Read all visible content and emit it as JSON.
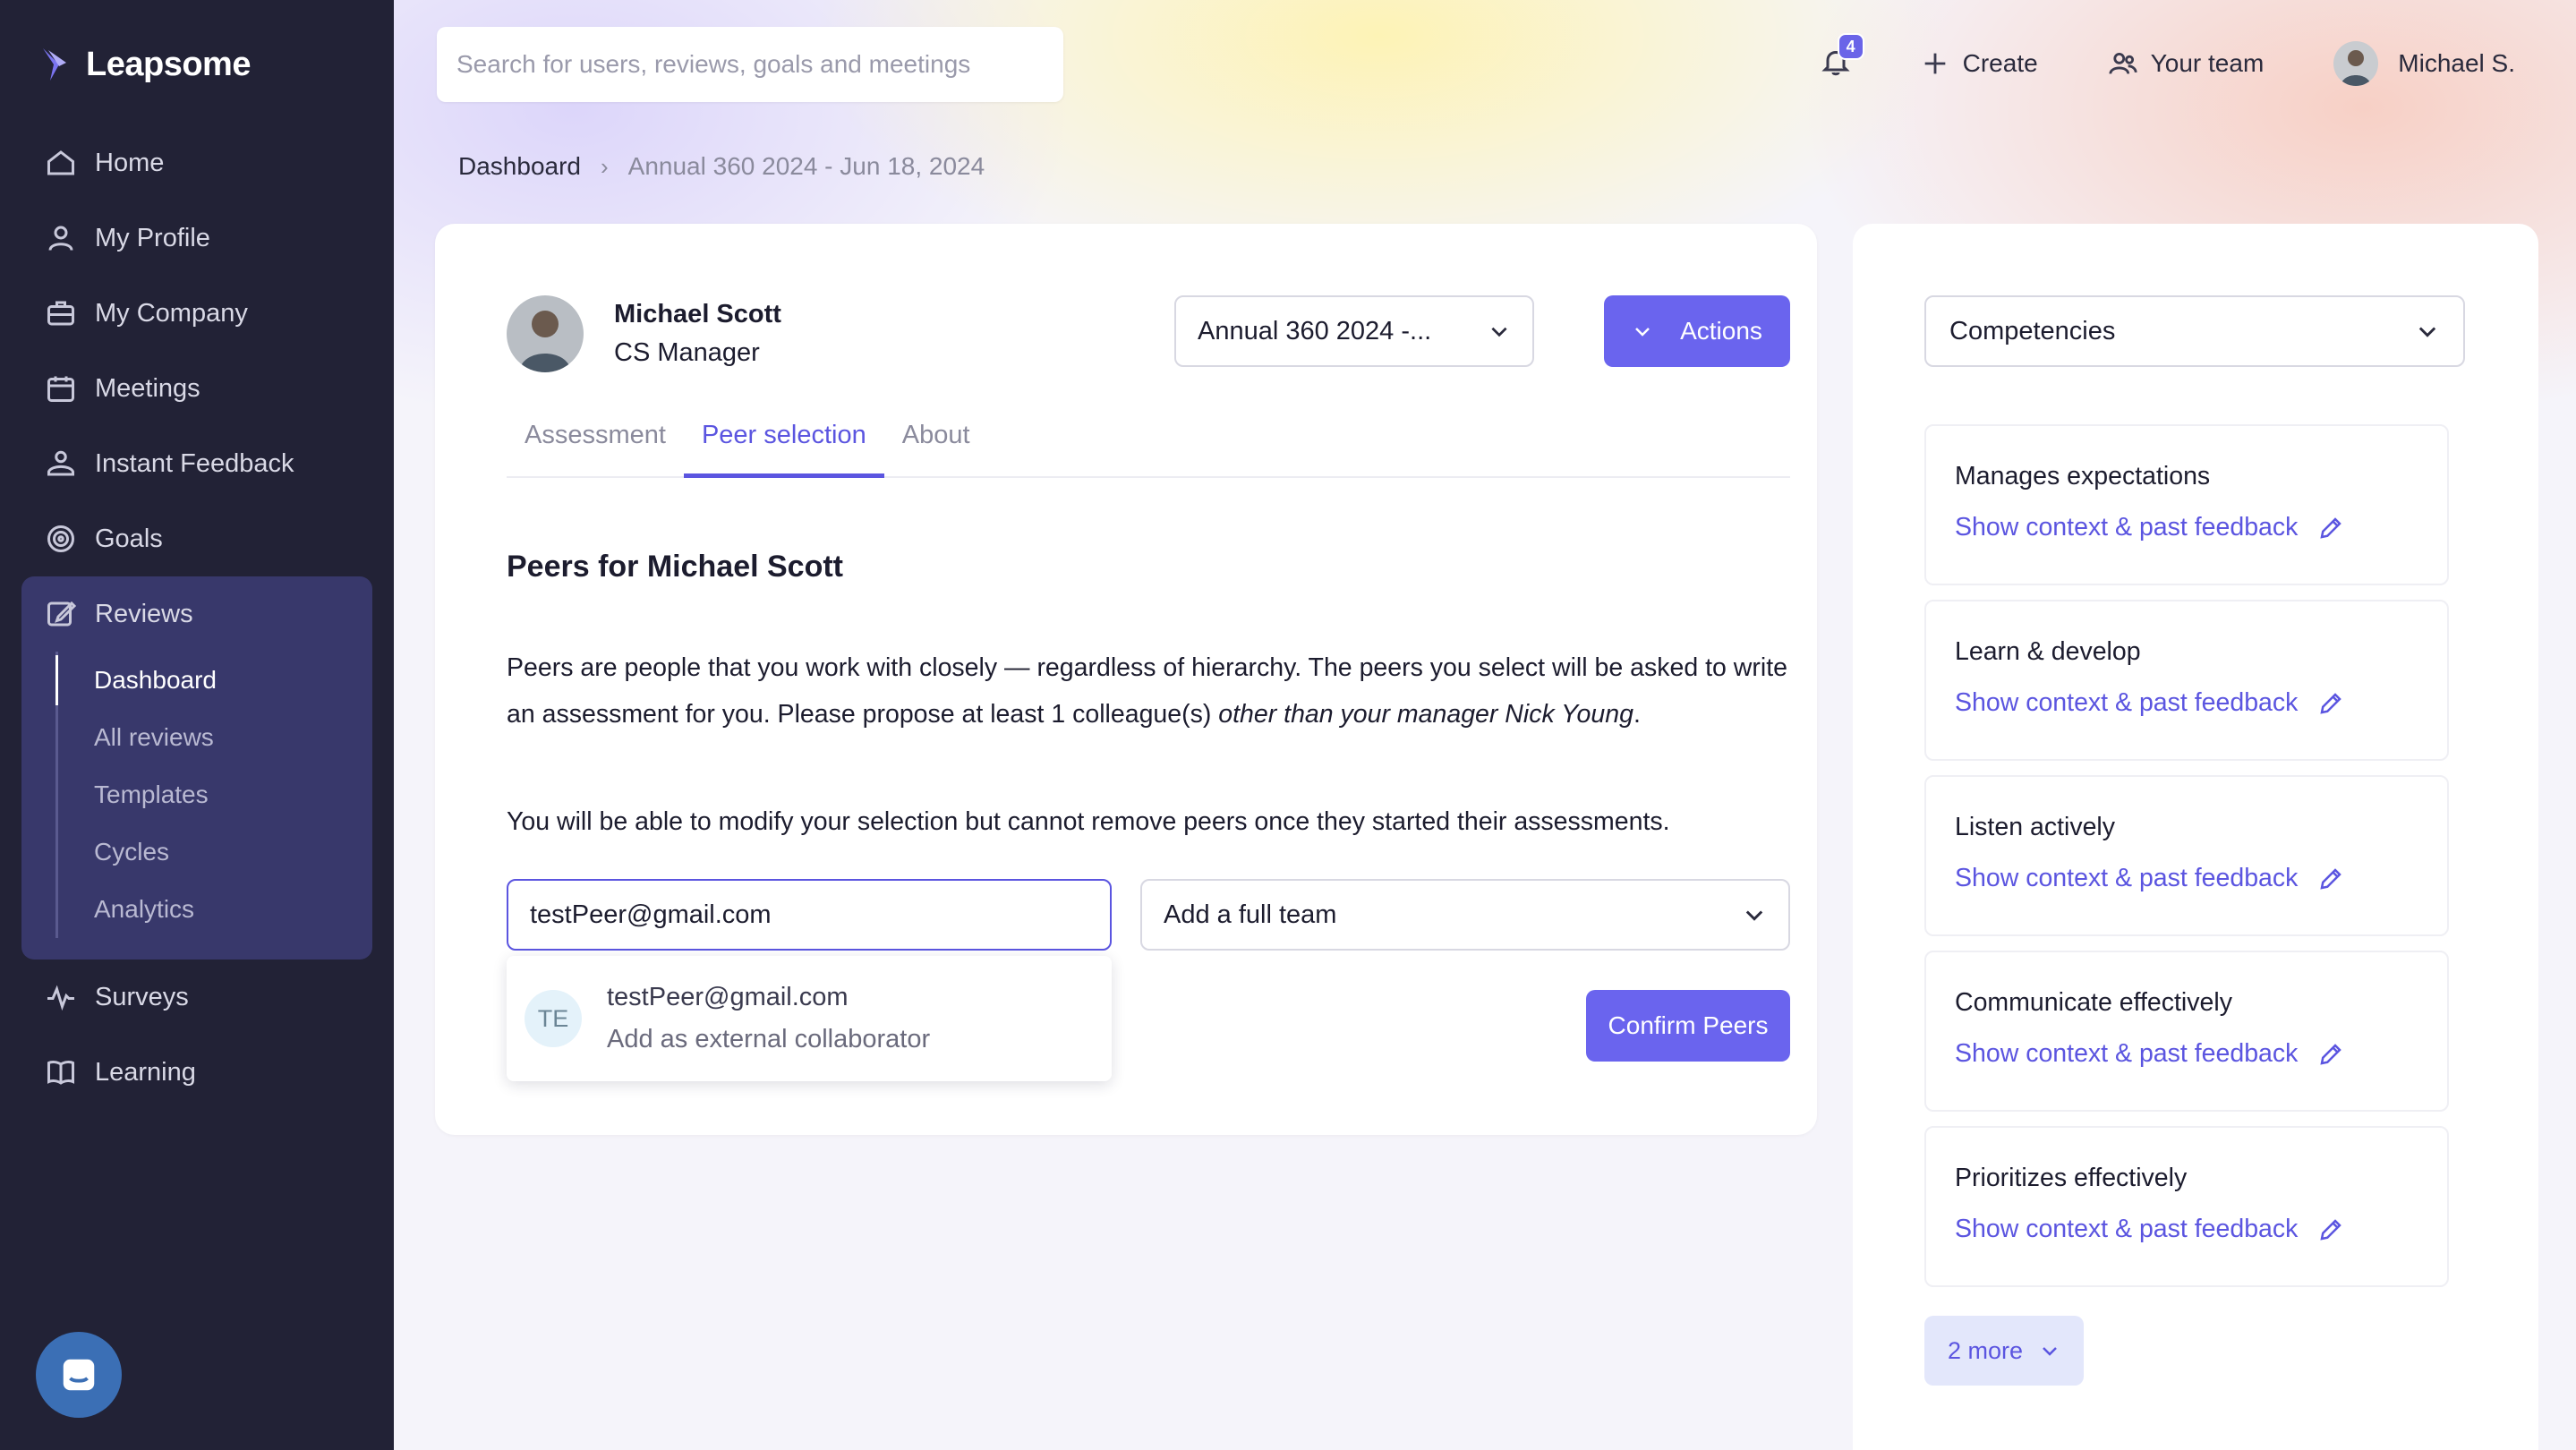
{
  "app": {
    "brand": "Leapsome"
  },
  "sidebar": {
    "items": [
      {
        "label": "Home",
        "icon": "home-icon"
      },
      {
        "label": "My Profile",
        "icon": "user-icon"
      },
      {
        "label": "My Company",
        "icon": "briefcase-icon"
      },
      {
        "label": "Meetings",
        "icon": "calendar-icon"
      },
      {
        "label": "Instant Feedback",
        "icon": "feedback-icon"
      },
      {
        "label": "Goals",
        "icon": "target-icon"
      }
    ],
    "reviews": {
      "label": "Reviews",
      "icon": "edit-icon",
      "sub_items": [
        "Dashboard",
        "All reviews",
        "Templates",
        "Cycles",
        "Analytics"
      ],
      "active_sub": "Dashboard"
    },
    "bottom_items": [
      {
        "label": "Surveys",
        "icon": "pulse-icon"
      },
      {
        "label": "Learning",
        "icon": "book-icon"
      }
    ]
  },
  "topbar": {
    "search_placeholder": "Search for users, reviews, goals and meetings",
    "notification_count": "4",
    "create_label": "Create",
    "team_label": "Your team",
    "user_label": "Michael S."
  },
  "breadcrumb": {
    "root": "Dashboard",
    "current": "Annual 360 2024 - Jun 18, 2024"
  },
  "review": {
    "person_name": "Michael Scott",
    "person_role": "CS Manager",
    "cycle_selected": "Annual 360 2024 -...",
    "actions_label": "Actions",
    "tabs": [
      "Assessment",
      "Peer selection",
      "About"
    ],
    "active_tab": "Peer selection",
    "section_title": "Peers for Michael Scott",
    "desc_part1": "Peers are people that you work with closely — regardless of hierarchy. The peers you select will be asked to write an assessment for you. Please propose at least 1 colleague(s) ",
    "desc_em": "other than your manager Nick Young",
    "desc_end": ".",
    "note": "You will be able to modify your selection but cannot remove peers once they started their assessments.",
    "peer_input_value": "testPeer@gmail.com",
    "team_select_label": "Add a full team",
    "suggestion": {
      "initials": "TE",
      "email": "testPeer@gmail.com",
      "hint": "Add as external collaborator"
    },
    "confirm_label": "Confirm Peers"
  },
  "competencies": {
    "select_label": "Competencies",
    "items": [
      {
        "name": "Manages expectations",
        "link": "Show context & past feedback"
      },
      {
        "name": "Learn & develop",
        "link": "Show context & past feedback"
      },
      {
        "name": "Listen actively",
        "link": "Show context & past feedback"
      },
      {
        "name": "Communicate effectively",
        "link": "Show context & past feedback"
      },
      {
        "name": "Prioritizes effectively",
        "link": "Show context & past feedback"
      }
    ],
    "more_label": "2 more"
  },
  "colors": {
    "sidebar_bg": "#222236",
    "reviews_group_bg": "#38386b",
    "accent": "#6a64ee",
    "link": "#5b55e0"
  }
}
